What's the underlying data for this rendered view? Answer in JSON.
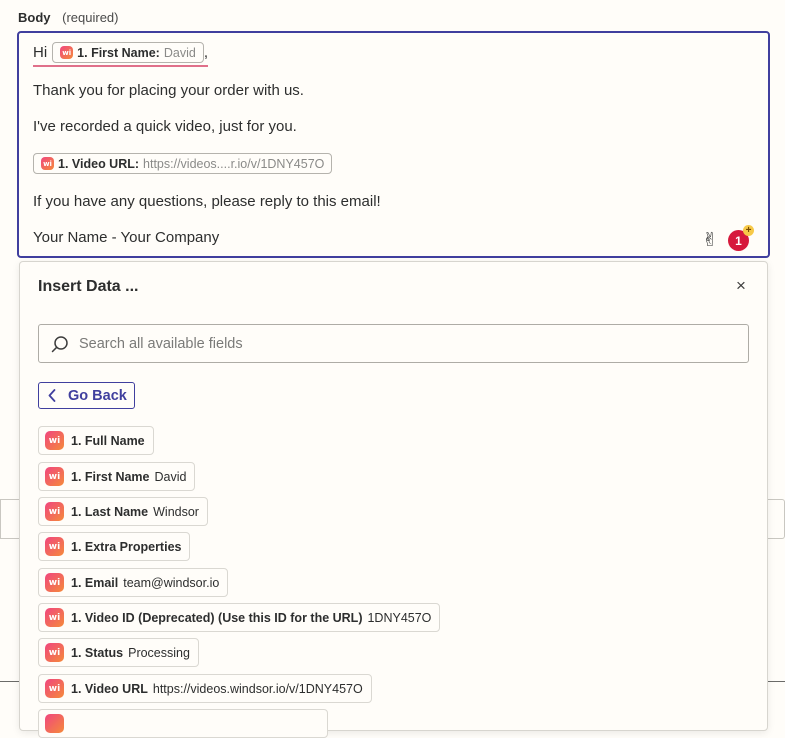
{
  "field": {
    "name": "Body",
    "required": "(required)"
  },
  "editor": {
    "greeting": "Hi",
    "first_name_pill": {
      "key": "1. First Name:",
      "value": "David"
    },
    "comma": ",",
    "line2": "Thank you for placing your order with us.",
    "line3": "I've recorded a quick video, just for you.",
    "video_pill": {
      "key": "1. Video URL:",
      "value": "https://videos....r.io/v/1DNY457O"
    },
    "line5": "If you have any questions, please reply to this email!",
    "line6": "Your Name - Your Company",
    "badge_count": "1",
    "badge_plus": "+"
  },
  "panel": {
    "title": "Insert Data ...",
    "close": "×",
    "search_placeholder": "Search all available fields",
    "back_label": "Go Back",
    "items": [
      {
        "key": "1. Full Name",
        "value": ""
      },
      {
        "key": "1. First Name",
        "value": "David"
      },
      {
        "key": "1. Last Name",
        "value": "Windsor"
      },
      {
        "key": "1. Extra Properties",
        "value": ""
      },
      {
        "key": "1. Email",
        "value": "team@windsor.io"
      },
      {
        "key": "1. Video ID (Deprecated) (Use this ID for the URL)",
        "value": "1DNY457O"
      },
      {
        "key": "1. Status",
        "value": "Processing"
      },
      {
        "key": "1. Video URL",
        "value": "https://videos.windsor.io/v/1DNY457O"
      }
    ]
  },
  "app_logo_text": "wi",
  "colors": {
    "accent": "#403f9e",
    "badge": "#d6193c",
    "brand_start": "#f0467f",
    "brand_end": "#f58a3a"
  }
}
